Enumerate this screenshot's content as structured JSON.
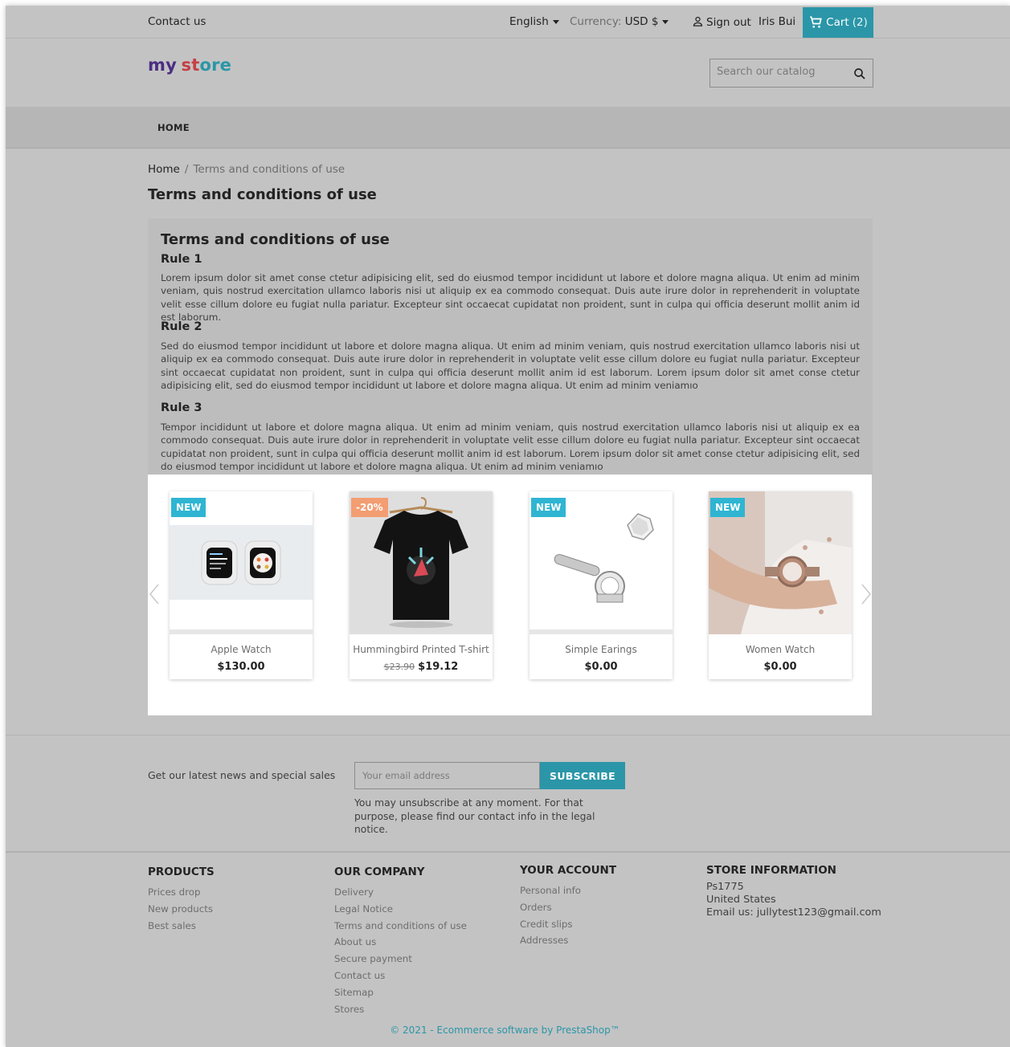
{
  "top_nav": {
    "contact": "Contact us",
    "language": "English",
    "currency_label": "Currency:",
    "currency_value": "USD $",
    "sign_out": "Sign out",
    "user_name": "Iris Bui",
    "cart_label": "Cart",
    "cart_count": "(2)"
  },
  "header": {
    "logo_part1": "my",
    "logo_part2": "st",
    "logo_part3": "ore",
    "search_placeholder": "Search our catalog"
  },
  "menu": {
    "home": "HOME"
  },
  "breadcrumb": {
    "home": "Home",
    "separator": "/",
    "current": "Terms and conditions of use"
  },
  "page_title": "Terms and conditions of use",
  "content": {
    "heading": "Terms and conditions of use",
    "rules": [
      {
        "title": "Rule 1",
        "text": "Lorem ipsum dolor sit amet conse ctetur adipisicing elit, sed do eiusmod tempor incididunt ut labore et dolore magna aliqua. Ut enim ad minim veniam, quis nostrud exercitation ullamco laboris nisi ut aliquip ex ea commodo consequat. Duis aute irure dolor in reprehenderit in voluptate velit esse cillum dolore eu fugiat nulla pariatur. Excepteur sint occaecat cupidatat non proident, sunt in culpa qui officia deserunt mollit anim id est laborum."
      },
      {
        "title": "Rule 2",
        "text": "Sed do eiusmod tempor incididunt ut labore et dolore magna aliqua. Ut enim ad minim veniam, quis nostrud exercitation ullamco laboris nisi ut aliquip ex ea commodo consequat. Duis aute irure dolor in reprehenderit in voluptate velit esse cillum dolore eu fugiat nulla pariatur. Excepteur sint occaecat cupidatat non proident, sunt in culpa qui officia deserunt mollit anim id est laborum. Lorem ipsum dolor sit amet conse ctetur adipisicing elit, sed do eiusmod tempor incididunt ut labore et dolore magna aliqua. Ut enim ad minim veniamıo"
      },
      {
        "title": "Rule 3",
        "text": "Tempor incididunt ut labore et dolore magna aliqua. Ut enim ad minim veniam, quis nostrud exercitation ullamco laboris nisi ut aliquip ex ea commodo consequat. Duis aute irure dolor in reprehenderit in voluptate velit esse cillum dolore eu fugiat nulla pariatur. Excepteur sint occaecat cupidatat non proident, sunt in culpa qui officia deserunt mollit anim id est laborum. Lorem ipsum dolor sit amet conse ctetur adipisicing elit, sed do eiusmod tempor incididunt ut labore et dolore magna aliqua. Ut enim ad minim veniamıo"
      }
    ]
  },
  "products": [
    {
      "name": "Apple Watch",
      "price": "$130.00",
      "old_price": "",
      "badge": "NEW",
      "badge_type": "new"
    },
    {
      "name": "Hummingbird Printed T-shirt",
      "price": "$19.12",
      "old_price": "$23.90",
      "badge": "-20%",
      "badge_type": "sale"
    },
    {
      "name": "Simple Earings",
      "price": "$0.00",
      "old_price": "",
      "badge": "NEW",
      "badge_type": "new"
    },
    {
      "name": "Women Watch",
      "price": "$0.00",
      "old_price": "",
      "badge": "NEW",
      "badge_type": "new"
    }
  ],
  "newsletter": {
    "text": "Get our latest news and special sales",
    "placeholder": "Your email address",
    "button": "SUBSCRIBE",
    "note": "You may unsubscribe at any moment. For that purpose, please find our contact info in the legal notice."
  },
  "footer": {
    "products": {
      "title": "PRODUCTS",
      "links": [
        "Prices drop",
        "New products",
        "Best sales"
      ]
    },
    "company": {
      "title": "OUR COMPANY",
      "links": [
        "Delivery",
        "Legal Notice",
        "Terms and conditions of use",
        "About us",
        "Secure payment",
        "Contact us",
        "Sitemap",
        "Stores"
      ]
    },
    "account": {
      "title": "YOUR ACCOUNT",
      "links": [
        "Personal info",
        "Orders",
        "Credit slips",
        "Addresses"
      ]
    },
    "store": {
      "title": "STORE INFORMATION",
      "lines": [
        "Ps1775",
        "United States",
        "Email us: jullytest123@gmail.com"
      ]
    },
    "copyright": "© 2021 - Ecommerce software by PrestaShop™"
  },
  "colors": {
    "accent": "#2b96a8",
    "badge_new": "#2fb5d2",
    "badge_sale": "#f39d72"
  }
}
